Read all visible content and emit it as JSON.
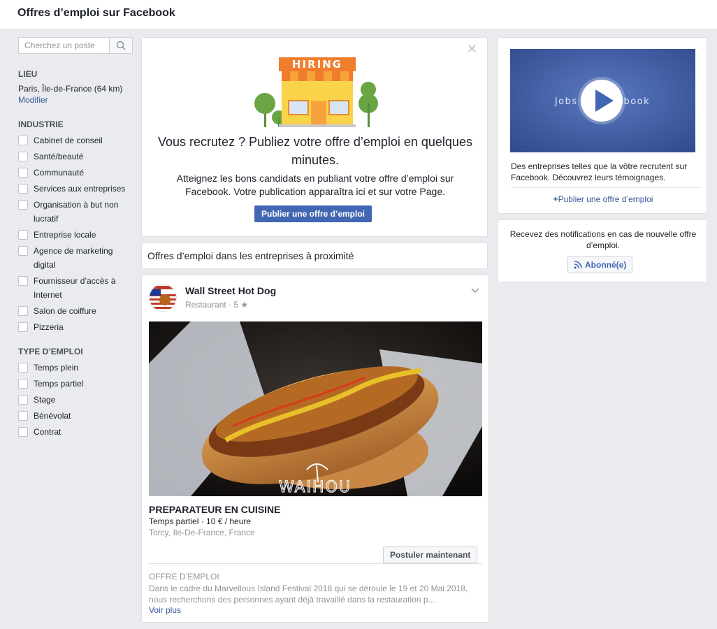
{
  "header": {
    "title": "Offres d’emploi sur Facebook"
  },
  "sidebar": {
    "search_placeholder": "Cherchez un poste",
    "location_title": "LIEU",
    "location_value": "Paris, Île-de-France (64 km)",
    "location_link": "Modifier",
    "industry_title": "INDUSTRIE",
    "industries": [
      "Cabinet de conseil",
      "Santé/beauté",
      "Communauté",
      "Services aux entreprises",
      "Organisation à but non lucratif",
      "Entreprise locale",
      "Agence de marketing digital",
      "Fournisseur d’accès à Internet",
      "Salon de coiffure",
      "Pizzeria"
    ],
    "job_type_title": "TYPE D’EMPLOI",
    "job_types": [
      "Temps plein",
      "Temps partiel",
      "Stage",
      "Bénévolat",
      "Contrat"
    ]
  },
  "promo": {
    "sign_text": "HIRING",
    "headline": "Vous recrutez ? Publiez votre offre d’emploi en quelques minutes.",
    "body": "Atteignez les bons candidats en publiant votre offre d’emploi sur Facebook. Votre publication apparaîtra ici et sur votre Page.",
    "button": "Publier une offre d’emploi"
  },
  "nearby": {
    "title": "Offres d’emploi dans les entreprises à proximité"
  },
  "post": {
    "business": "Wall Street Hot Dog",
    "meta": "Restaurant · 5 ★",
    "photo_watermark": "WAIHOU",
    "job_title": "PREPARATEUR EN CUISINE",
    "job_info": "Temps partiel · 10 € / heure",
    "job_location": "Torcy, Ile-De-France, France",
    "apply_button": "Postuler maintenant",
    "offer_label": "OFFRE D’EMPLOI",
    "description": "Dans le cadre du Marvellous Island Festival 2018 qui se déroule le 19 et 20 Mai 2018, nous recherchons des personnes ayant déjà travaillé dans la restauration p...",
    "more_link": "Voir plus"
  },
  "video_card": {
    "video_caption": "Jobs on Facebook",
    "text": "Des entreprises telles que la vôtre recrutent sur Facebook. Découvrez leurs témoignages.",
    "link": "Publier une offre d’emploi"
  },
  "notify_card": {
    "text": "Recevez des notifications en cas de nouvelle offre d’emploi.",
    "button": "Abonné(e)"
  },
  "colors": {
    "brand_blue": "#4267b2",
    "link": "#365899",
    "background": "#e9ebee"
  }
}
